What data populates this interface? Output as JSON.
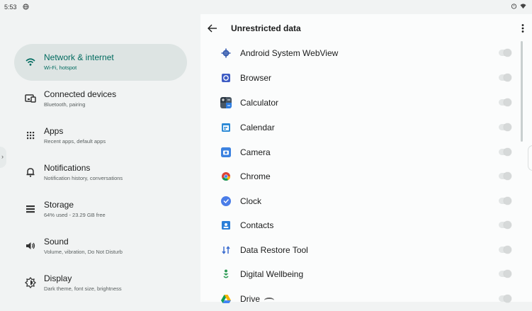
{
  "status_bar": {
    "time": "5:53"
  },
  "sidebar": {
    "items": [
      {
        "title": "Network & internet",
        "subtitle": "Wi‑Fi, hotspot",
        "icon": "wifi-icon",
        "selected": true
      },
      {
        "title": "Connected devices",
        "subtitle": "Bluetooth, pairing",
        "icon": "devices-icon",
        "selected": false
      },
      {
        "title": "Apps",
        "subtitle": "Recent apps, default apps",
        "icon": "apps-grid-icon",
        "selected": false
      },
      {
        "title": "Notifications",
        "subtitle": "Notification history, conversations",
        "icon": "bell-icon",
        "selected": false
      },
      {
        "title": "Storage",
        "subtitle": "64% used - 23.29 GB free",
        "icon": "storage-icon",
        "selected": false
      },
      {
        "title": "Sound",
        "subtitle": "Volume, vibration, Do Not Disturb",
        "icon": "speaker-icon",
        "selected": false
      },
      {
        "title": "Display",
        "subtitle": "Dark theme, font size, brightness",
        "icon": "brightness-icon",
        "selected": false
      }
    ]
  },
  "page": {
    "title": "Unrestricted data"
  },
  "apps": [
    {
      "name": "Android System WebView",
      "icon": "webview-icon",
      "enabled": false
    },
    {
      "name": "Browser",
      "icon": "browser-icon",
      "enabled": false
    },
    {
      "name": "Calculator",
      "icon": "calculator-icon",
      "enabled": false
    },
    {
      "name": "Calendar",
      "icon": "calendar-icon",
      "enabled": false
    },
    {
      "name": "Camera",
      "icon": "camera-icon",
      "enabled": false
    },
    {
      "name": "Chrome",
      "icon": "chrome-icon",
      "enabled": false
    },
    {
      "name": "Clock",
      "icon": "clock-icon",
      "enabled": false
    },
    {
      "name": "Contacts",
      "icon": "contacts-icon",
      "enabled": false
    },
    {
      "name": "Data Restore Tool",
      "icon": "data-restore-icon",
      "enabled": false
    },
    {
      "name": "Digital Wellbeing",
      "icon": "wellbeing-icon",
      "enabled": false
    },
    {
      "name": "Drive",
      "icon": "drive-icon",
      "enabled": false
    }
  ],
  "colors": {
    "accent": "#006b5f",
    "selected_bg": "#dde4e3",
    "toggle_off": "#d6d9d9"
  }
}
